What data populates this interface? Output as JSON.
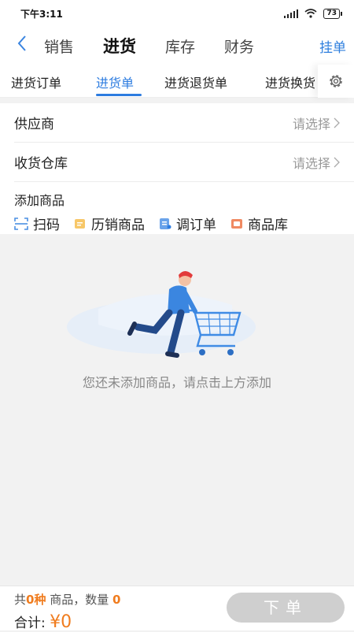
{
  "status": {
    "time": "下午3:11",
    "battery": "73"
  },
  "topnav": {
    "tabs": [
      {
        "label": "销售"
      },
      {
        "label": "进货"
      },
      {
        "label": "库存"
      },
      {
        "label": "财务"
      }
    ],
    "right_label": "挂单"
  },
  "subtabs": [
    {
      "label": "进货订单"
    },
    {
      "label": "进货单"
    },
    {
      "label": "进货退货单"
    },
    {
      "label": "进货换货"
    }
  ],
  "form": {
    "supplier": {
      "label": "供应商",
      "value": "请选择"
    },
    "warehouse": {
      "label": "收货仓库",
      "value": "请选择"
    },
    "add": {
      "title": "添加商品",
      "options": [
        {
          "label": "扫码"
        },
        {
          "label": "历销商品"
        },
        {
          "label": "调订单"
        },
        {
          "label": "商品库"
        }
      ]
    }
  },
  "empty": {
    "message": "您还未添加商品，请点击上方添加"
  },
  "footer": {
    "summary": {
      "prefix": "共",
      "kinds": "0种",
      "middle": "商品，数量",
      "qty": "0"
    },
    "total": {
      "label": "合计:",
      "amount": "¥0"
    },
    "submit_label": "下单"
  },
  "colors": {
    "accent": "#2d7ce0",
    "orange": "#f07c1e"
  }
}
